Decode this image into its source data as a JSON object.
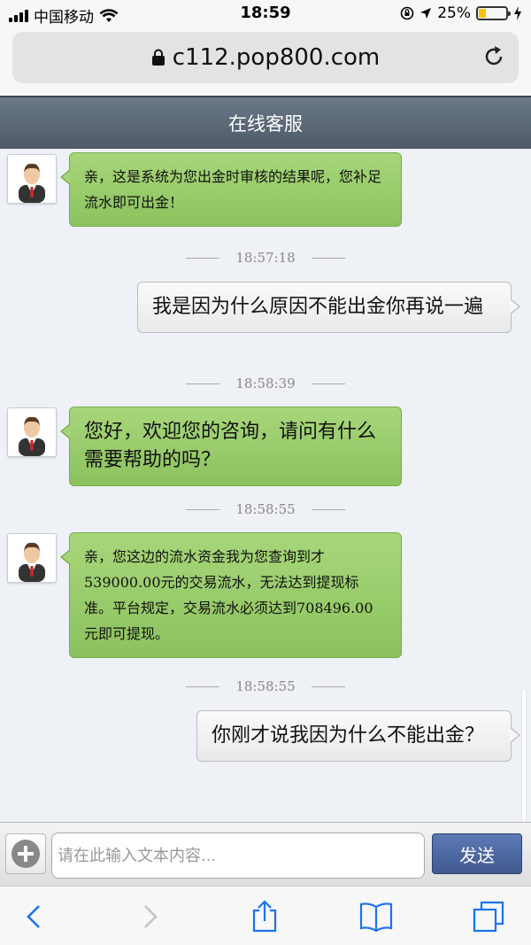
{
  "status_bar": {
    "carrier": "中国移动",
    "time": "18:59",
    "battery_percent": "25%",
    "battery_level": 0.25
  },
  "browser": {
    "url": "c112.pop800.com"
  },
  "header": {
    "title": "在线客服"
  },
  "messages": [
    {
      "from": "agent",
      "text": "亲，这是系统为您出金时审核的结果呢，您补足流水即可出金！"
    },
    {
      "timestamp": "18:57:18"
    },
    {
      "from": "user",
      "text": "我是因为什么原因不能出金你再说一遍"
    },
    {
      "timestamp": "18:58:39"
    },
    {
      "from": "agent",
      "text": "您好，欢迎您的咨询，请问有什么需要帮助的吗？"
    },
    {
      "timestamp": "18:58:55"
    },
    {
      "from": "agent",
      "text": "亲，您这边的流水资金我为您查询到才539000.00元的交易流水，无法达到提现标准。平台规定，交易流水必须达到708496.00元即可提现。"
    },
    {
      "timestamp": "18:58:55"
    },
    {
      "from": "user",
      "text": "你刚才说我因为什么不能出金？"
    }
  ],
  "input": {
    "placeholder": "请在此输入文本内容...",
    "send_label": "发送"
  },
  "toolbar": {
    "icons": [
      "back-icon",
      "forward-icon",
      "share-icon",
      "bookmarks-icon",
      "tabs-icon"
    ]
  },
  "colors": {
    "header_bg": "#5b6877",
    "agent_bubble": "#98cc68",
    "send_button": "#4a65a0"
  }
}
